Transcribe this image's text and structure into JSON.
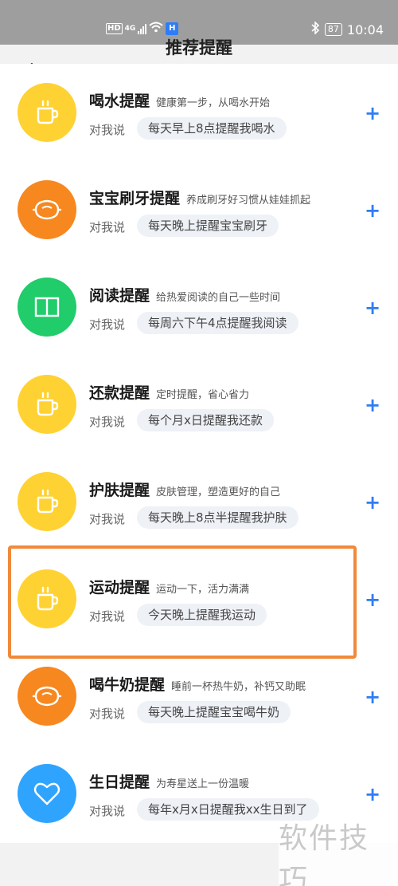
{
  "status_bar": {
    "hd": "HD",
    "network": "4G",
    "time": "10:04",
    "battery": "87"
  },
  "header": {
    "title": "推荐提醒"
  },
  "reminders": [
    {
      "name": "喝水提醒",
      "desc": "健康第一步，从喝水开始",
      "say": "对我说",
      "example": "每天早上8点提醒我喝水",
      "icon": "cup-icon",
      "color": "#ffd233"
    },
    {
      "name": "宝宝刷牙提醒",
      "desc": "养成刷牙好习惯从娃娃抓起",
      "say": "对我说",
      "example": "每天晚上提醒宝宝刷牙",
      "icon": "lemon-icon",
      "color": "#f7871f"
    },
    {
      "name": "阅读提醒",
      "desc": "给热爱阅读的自己一些时间",
      "say": "对我说",
      "example": "每周六下午4点提醒我阅读",
      "icon": "book-icon",
      "color": "#21cc6b"
    },
    {
      "name": "还款提醒",
      "desc": "定时提醒，省心省力",
      "say": "对我说",
      "example": "每个月x日提醒我还款",
      "icon": "cup-icon",
      "color": "#ffd233"
    },
    {
      "name": "护肤提醒",
      "desc": "皮肤管理，塑造更好的自己",
      "say": "对我说",
      "example": "每天晚上8点半提醒我护肤",
      "icon": "cup-icon",
      "color": "#ffd233"
    },
    {
      "name": "运动提醒",
      "desc": "运动一下，活力满满",
      "say": "对我说",
      "example": "今天晚上提醒我运动",
      "icon": "cup-icon",
      "color": "#ffd233"
    },
    {
      "name": "喝牛奶提醒",
      "desc": "睡前一杯热牛奶，补钙又助眠",
      "say": "对我说",
      "example": "每天晚上提醒宝宝喝牛奶",
      "icon": "lemon-icon",
      "color": "#f7871f"
    },
    {
      "name": "生日提醒",
      "desc": "为寿星送上一份温暖",
      "say": "对我说",
      "example": "每年x月x日提醒我xx生日到了",
      "icon": "heart-icon",
      "color": "#2fa4ff"
    }
  ],
  "plus_label": "+",
  "watermark": "软件技巧",
  "colors": {
    "accent": "#2f7df6",
    "highlight": "#f08a3b"
  }
}
